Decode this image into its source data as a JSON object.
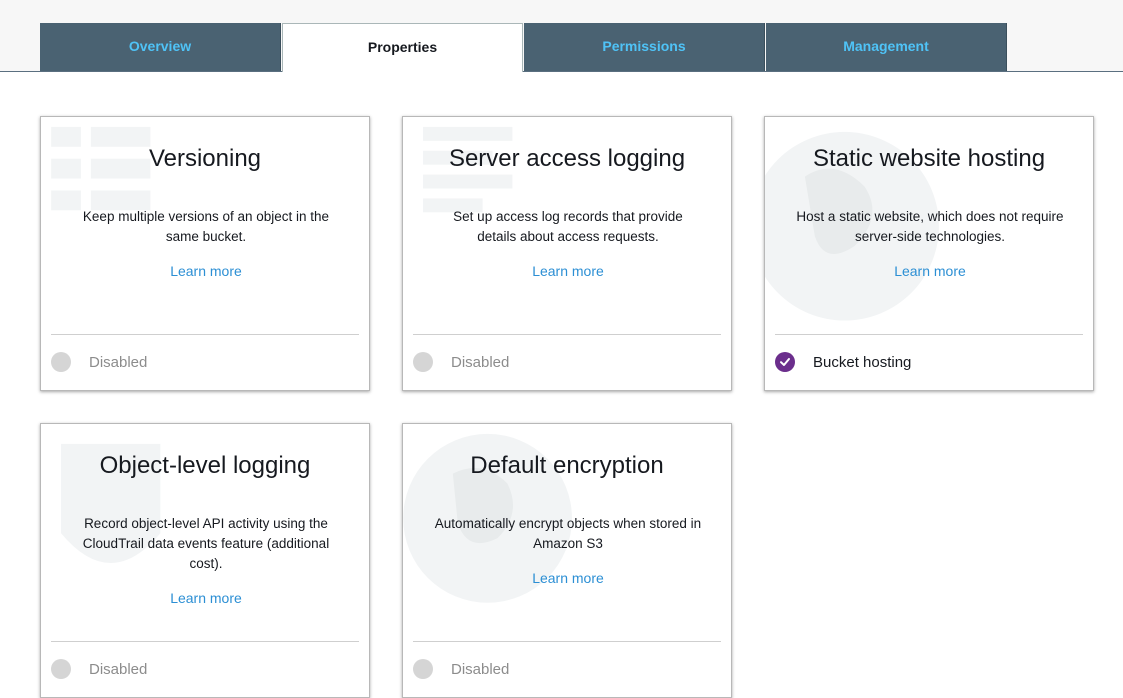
{
  "tabs": [
    {
      "label": "Overview",
      "active": false
    },
    {
      "label": "Properties",
      "active": true
    },
    {
      "label": "Permissions",
      "active": false
    },
    {
      "label": "Management",
      "active": false
    }
  ],
  "cards": [
    {
      "title": "Versioning",
      "description": "Keep multiple versions of an object in the same bucket.",
      "learn_more": "Learn more",
      "status": "Disabled",
      "status_state": "disabled",
      "bg_icon": "list-icon"
    },
    {
      "title": "Server access logging",
      "description": "Set up access log records that provide details about access requests.",
      "learn_more": "Learn more",
      "status": "Disabled",
      "status_state": "disabled",
      "bg_icon": "list-icon"
    },
    {
      "title": "Static website hosting",
      "description": "Host a static website, which does not require server-side technologies.",
      "learn_more": "Learn more",
      "status": "Bucket hosting",
      "status_state": "enabled",
      "bg_icon": "globe-icon"
    },
    {
      "title": "Object-level logging",
      "description": "Record object-level API activity using the CloudTrail data events feature (additional cost).",
      "learn_more": "Learn more",
      "status": "Disabled",
      "status_state": "disabled",
      "bg_icon": "shield-icon"
    },
    {
      "title": "Default encryption",
      "description": "Automatically encrypt objects when stored in Amazon S3",
      "learn_more": "Learn more",
      "status": "Disabled",
      "status_state": "disabled",
      "bg_icon": "globe-icon"
    }
  ],
  "colors": {
    "tab_bg": "#4a6272",
    "tab_text": "#4fc3f7",
    "link": "#2c8fd4",
    "enabled_check": "#6b2e8c",
    "disabled_dot": "#d5d5d5"
  }
}
